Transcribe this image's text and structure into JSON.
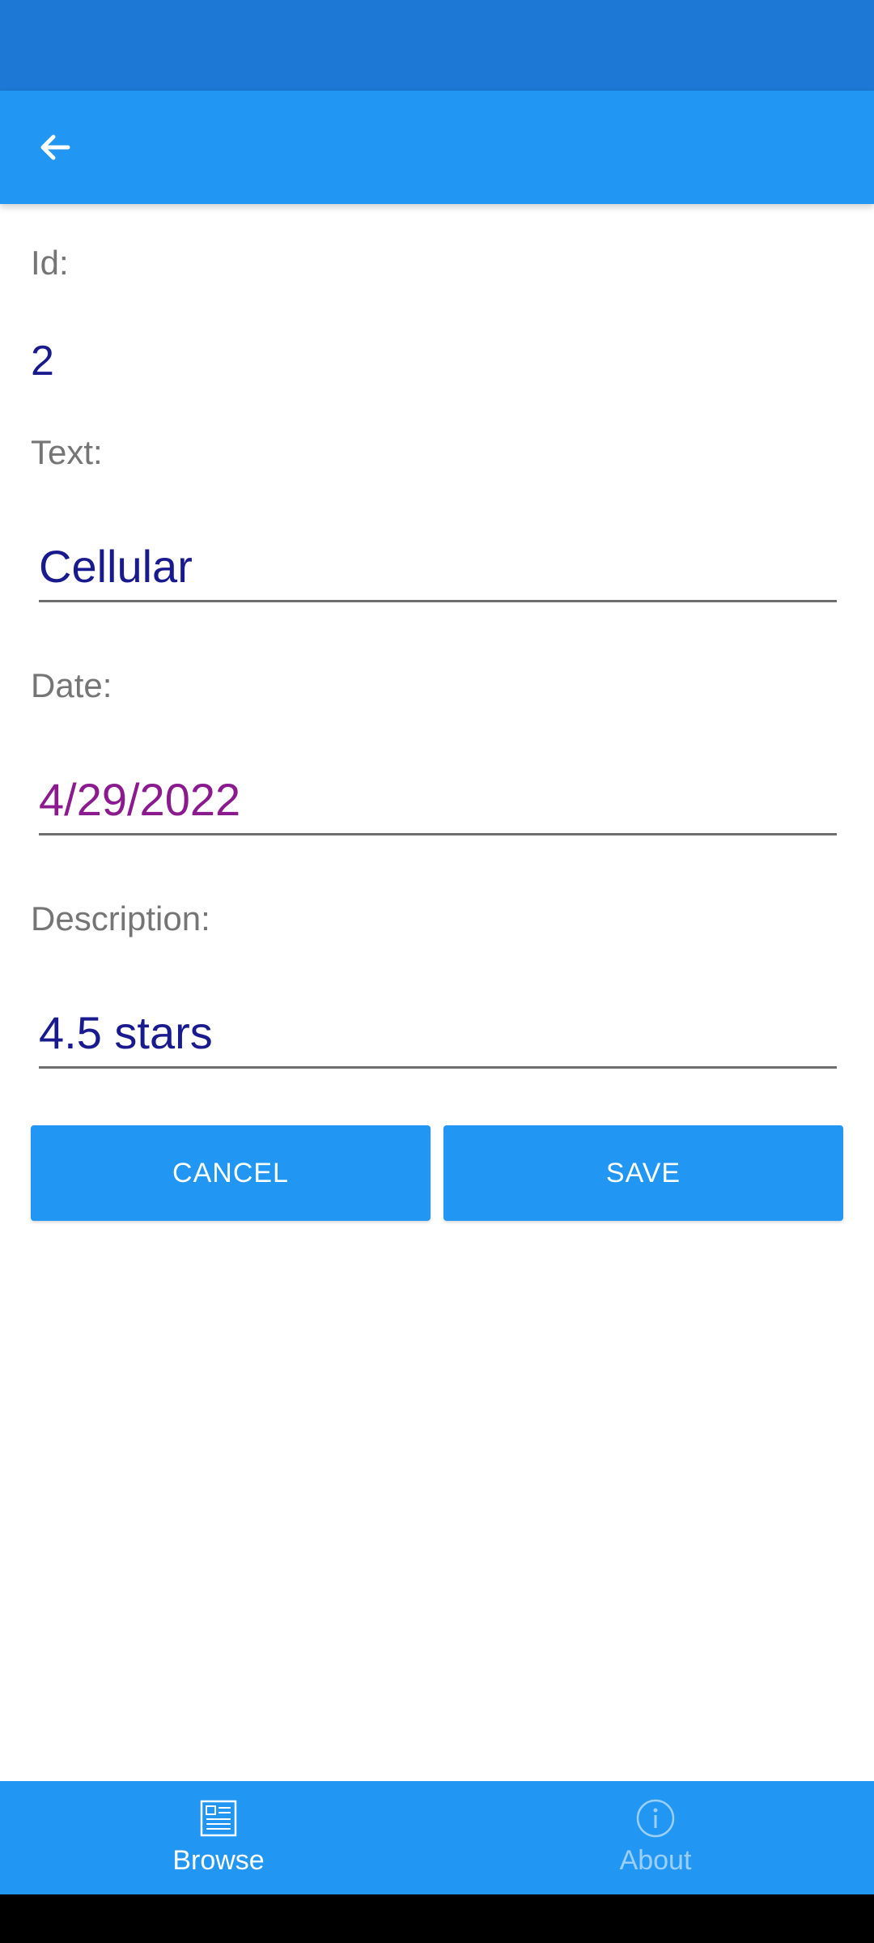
{
  "header": {
    "back_icon": "arrow-left-icon"
  },
  "form": {
    "id_label": "Id:",
    "id_value": "2",
    "text_label": "Text:",
    "text_value": "Cellular",
    "date_label": "Date:",
    "date_value": "4/29/2022",
    "description_label": "Description:",
    "description_value": "4.5 stars"
  },
  "actions": {
    "cancel_label": "CANCEL",
    "save_label": "SAVE"
  },
  "tabs": [
    {
      "label": "Browse",
      "icon": "browse-icon",
      "active": true
    },
    {
      "label": "About",
      "icon": "info-icon",
      "active": false
    }
  ],
  "colors": {
    "status_bar": "#1c78d4",
    "app_bar": "#2196f3",
    "accent": "#2196f3",
    "value_text": "#1a1a8f",
    "date_text": "#8b1a8f",
    "label_text": "#757575"
  }
}
